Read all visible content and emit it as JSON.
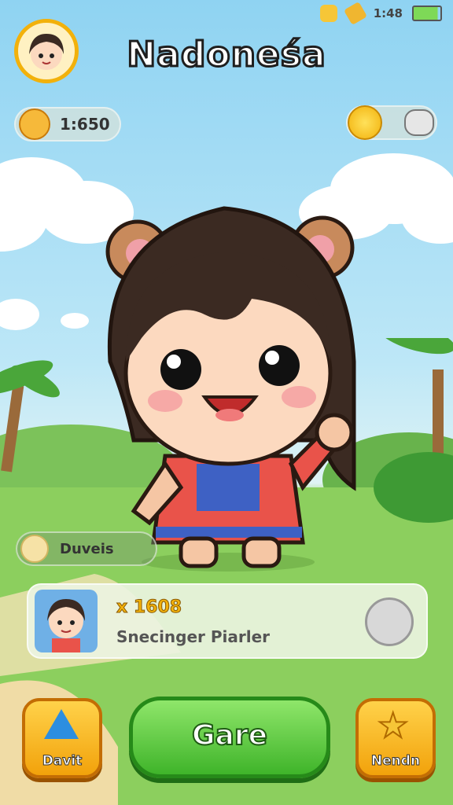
{
  "status": {
    "time": "1:48"
  },
  "header": {
    "title": "Nadoneśa"
  },
  "currency_left": {
    "value": "1:650",
    "icon": "chicken-icon"
  },
  "currency_right": {
    "icon": "coin-icon",
    "pet_icon": "bear-icon"
  },
  "badge": {
    "label": "Duveis"
  },
  "player_card": {
    "score": "x 1608",
    "name": "Snecinger Piarler"
  },
  "buttons": {
    "left_label": "Davit",
    "main_label": "Gare",
    "right_label": "Nendn"
  }
}
